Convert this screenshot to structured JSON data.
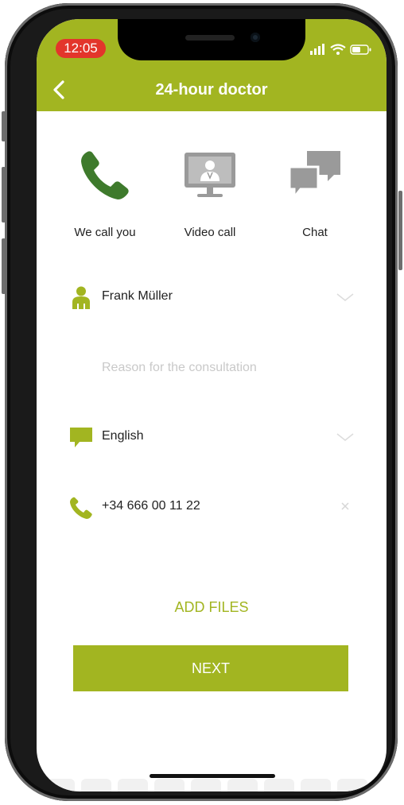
{
  "status_bar": {
    "time": "12:05"
  },
  "header": {
    "title": "24-hour doctor",
    "back_icon": "chevron-left-icon"
  },
  "contact_options": [
    {
      "label": "We call you",
      "icon": "phone-icon",
      "color": "#3e7a2c"
    },
    {
      "label": "Video call",
      "icon": "video-doctor-icon",
      "color": "#9a9a9a"
    },
    {
      "label": "Chat",
      "icon": "chat-bubbles-icon",
      "color": "#9a9a9a"
    }
  ],
  "form": {
    "patient": {
      "value": "Frank Müller",
      "icon": "person-icon"
    },
    "reason": {
      "placeholder": "Reason for the consultation"
    },
    "language": {
      "value": "English",
      "icon": "speech-bubble-icon"
    },
    "phone": {
      "value": "+34 666 00 11 22",
      "icon": "phone-icon"
    }
  },
  "actions": {
    "add_files": "ADD FILES",
    "next": "NEXT"
  },
  "colors": {
    "accent": "#a2b521",
    "selected_option": "#3e7a2c",
    "status_time_bg": "#e3352b"
  }
}
